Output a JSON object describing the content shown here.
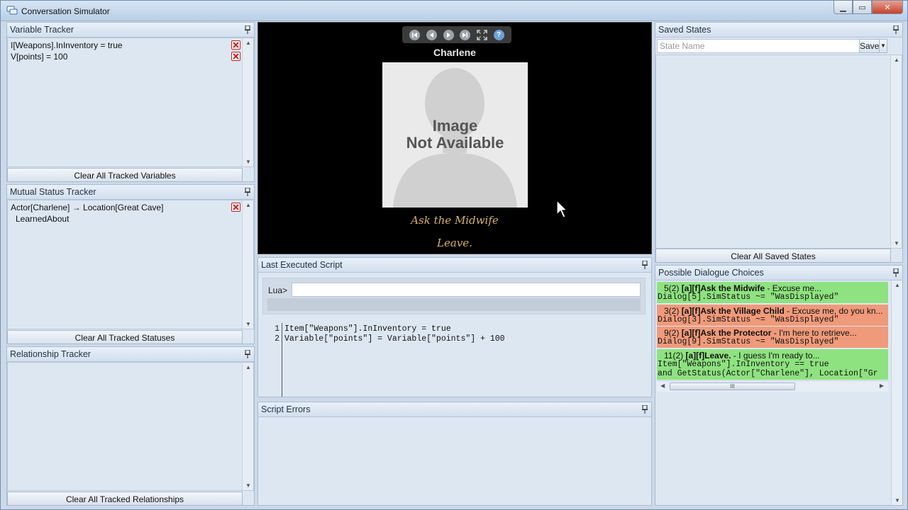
{
  "window": {
    "title": "Conversation Simulator"
  },
  "variable_tracker": {
    "title": "Variable Tracker",
    "rows": [
      "I[Weapons].InInventory = true",
      "V[points] = 100"
    ],
    "clear_label": "Clear All Tracked Variables"
  },
  "mutual_status_tracker": {
    "title": "Mutual Status Tracker",
    "rows": [
      "Actor[Charlene] → Location[Great Cave]",
      "LearnedAbout"
    ],
    "clear_label": "Clear All Tracked Statuses"
  },
  "relationship_tracker": {
    "title": "Relationship Tracker",
    "clear_label": "Clear All Tracked Relationships"
  },
  "stage": {
    "actor_name": "Charlene",
    "portrait_line1": "Image",
    "portrait_line2": "Not Available",
    "choices": [
      "Ask the Midwife",
      "Leave."
    ],
    "help_label": "?"
  },
  "last_executed_script": {
    "title": "Last Executed Script",
    "lua_prompt": "Lua>",
    "lua_value": "",
    "lines": [
      {
        "n": "1",
        "text": "Item[\"Weapons\"].InInventory = true"
      },
      {
        "n": "2",
        "text": "Variable[\"points\"] = Variable[\"points\"] + 100"
      }
    ]
  },
  "script_errors": {
    "title": "Script Errors"
  },
  "saved_states": {
    "title": "Saved States",
    "placeholder": "State Name",
    "save_label": "Save",
    "clear_label": "Clear All Saved States"
  },
  "dialogue_choices": {
    "title": "Possible Dialogue Choices",
    "items": [
      {
        "id": "5(2) ",
        "name": "[a][f]Ask the Midwife",
        "rest": " - Excuse me...",
        "cond1": "Dialog[5].SimStatus ~= \"WasDisplayed\"",
        "cond2": "",
        "state": "valid"
      },
      {
        "id": "3(2) ",
        "name": "[a][f]Ask the Village Child",
        "rest": " - Excuse me, do you kn...",
        "cond1": "Dialog[3].SimStatus ~= \"WasDisplayed\"",
        "cond2": "",
        "state": "invalid"
      },
      {
        "id": "9(2) ",
        "name": "[a][f]Ask the Protector",
        "rest": " - I'm here to retrieve...",
        "cond1": "Dialog[9].SimStatus ~= \"WasDisplayed\"",
        "cond2": "",
        "state": "invalid"
      },
      {
        "id": "11(2) ",
        "name": "[a][f]Leave.",
        "rest": " - I guess I'm ready to...",
        "cond1": "Item[\"Weapons\"].InInventory == true",
        "cond2": "and GetStatus(Actor[\"Charlene\"], Location[\"Gr",
        "state": "valid"
      }
    ],
    "scroll_thumb": "III"
  },
  "colors": {
    "valid": "#8ee27f",
    "invalid": "#ef9a7a",
    "stage_choice": "#d6b26a"
  }
}
